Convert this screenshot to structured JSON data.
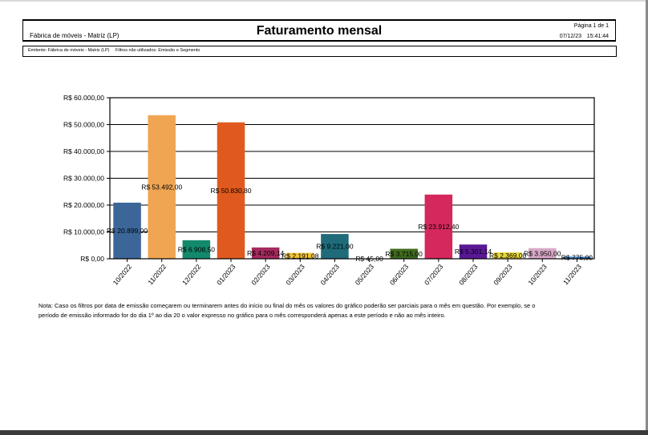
{
  "header": {
    "company": "Fábrica de móveis - Matriz (LP)",
    "title": "Faturamento mensal",
    "page": "Página 1 de 1",
    "date": "07/12/23",
    "time": "15:41:44"
  },
  "filters": {
    "issuer": "Emitente: Fábrica de móveis - Matriz (LP)",
    "unused": "Filtros não utilizados: Emissão e Segmento"
  },
  "chart_data": {
    "type": "bar",
    "categories": [
      "10/2022",
      "11/2022",
      "12/2022",
      "01/2023",
      "02/2023",
      "03/2023",
      "04/2023",
      "05/2023",
      "06/2023",
      "07/2023",
      "08/2023",
      "09/2023",
      "10/2023",
      "11/2023"
    ],
    "values": [
      20899.0,
      53492.0,
      6908.5,
      50830.8,
      4209.14,
      2191.08,
      9221.0,
      45.0,
      3715.0,
      23912.4,
      5301.14,
      2369.0,
      3950.0,
      775.0
    ],
    "value_labels": [
      "R$ 20.899,00",
      "R$ 53.492,00",
      "R$ 6.908,50",
      "R$ 50.830,80",
      "R$ 4.209,14",
      "R$ 2.191,08",
      "R$ 9.221,00",
      "R$ 45,00",
      "R$ 3.715,00",
      "R$ 23.912,40",
      "R$ 5.301,14",
      "R$ 2.369,00",
      "R$ 3.950,00",
      "R$ 775,00"
    ],
    "colors": [
      "#3c6698",
      "#f0a552",
      "#13896b",
      "#e05a1f",
      "#a52a5e",
      "#f2c43a",
      "#1f6b7a",
      "#c8c8c8",
      "#3f6b1e",
      "#d5285c",
      "#5a1896",
      "#e8d83a",
      "#d8a8c8",
      "#3b7fc4"
    ],
    "y_ticks": [
      0,
      10000,
      20000,
      30000,
      40000,
      50000,
      60000
    ],
    "y_tick_labels": [
      "R$ 0,00",
      "R$ 10.000,00",
      "R$ 20.000,00",
      "R$ 30.000,00",
      "R$ 40.000,00",
      "R$ 50.000,00",
      "R$ 60.000,00"
    ],
    "ylim": [
      0,
      60000
    ],
    "grid": true,
    "legend": "none",
    "title": "",
    "xlabel": "",
    "ylabel": ""
  },
  "note": "Nota: Caso os filtros por data de emissão começarem ou terminarem antes do início ou final do mês os valores do gráfico poderão ser parciais para o mês em questão. Por exemplo, se o período de emissão informado for do dia 1º ao dia 20 o valor expresso no gráfico para o mês corresponderá apenas a este período e não ao mês inteiro."
}
